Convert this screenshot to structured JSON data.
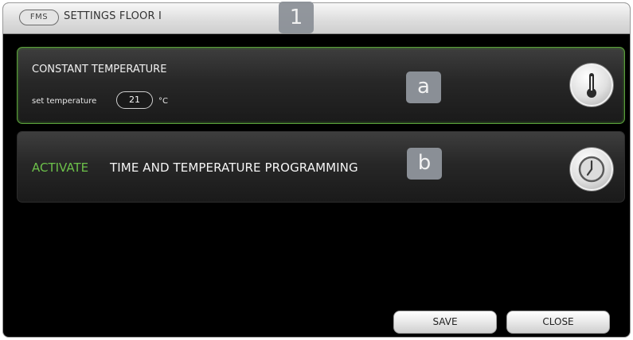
{
  "titlebar": {
    "badge": "FMS",
    "title": "SETTINGS FLOOR I"
  },
  "markers": {
    "one": "1",
    "a": "a",
    "b": "b"
  },
  "constant_panel": {
    "title": "CONSTANT TEMPERATURE",
    "set_label": "set temperature",
    "temperature_value": "21",
    "unit": "°C",
    "icon": "thermometer-icon"
  },
  "program_panel": {
    "activate_label": "ACTIVATE",
    "text": "TIME AND TEMPERATURE PROGRAMMING",
    "icon": "clock-icon"
  },
  "buttons": {
    "save": "SAVE",
    "close": "CLOSE"
  },
  "colors": {
    "accent_green": "#6cc04a",
    "panel_border_active": "#5aa03a",
    "marker": "#8a8f96"
  }
}
